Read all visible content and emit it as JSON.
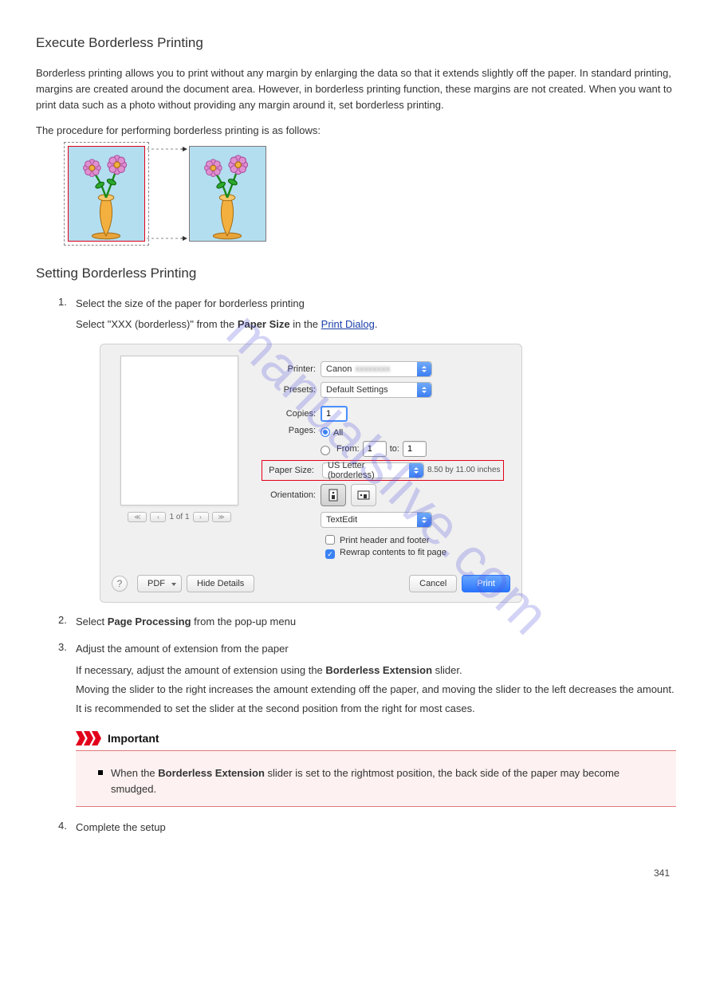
{
  "document": {
    "heading_main": "Execute Borderless Printing",
    "intro1": "Borderless printing allows you to print without any margin by enlarging the data so that it extends slightly off the paper. In standard printing, margins are created around the document area. However, in borderless printing function, these margins are not created. When you want to print data such as a photo without providing any margin around it, set borderless printing.",
    "intro2": "The procedure for performing borderless printing is as follows:",
    "section_setting": "Setting Borderless Printing",
    "step1_num": "1.",
    "step1_text_a": "Select the size of the paper for borderless printing",
    "step1_text_b_1": "Select \"XXX (borderless)\" from the ",
    "step1_text_b_bold": "Paper Size",
    "step1_text_b_2": " in the ",
    "step1_link": "Print Dialog",
    "step1_text_b_3": ".",
    "step2_num": "2.",
    "step2_bold": "Page Processing",
    "step2_text": " from the pop-up menu",
    "step3_num": "3.",
    "step3_text": "Adjust the amount of extension from the paper",
    "step3_para_1": "If necessary, adjust the amount of extension using the ",
    "step3_para_bold": "Borderless Extension",
    "step3_para_2": " slider.",
    "step3_para_3": "Moving the slider to the right increases the amount extending off the paper, and moving the slider to the left decreases the amount.",
    "step3_para_4": "It is recommended to set the slider at the second position from the right for most cases.",
    "important_label": "Important",
    "important_text": "When the Borderless Extension slider is set to the rightmost position, the back side of the paper may become smudged.",
    "step4_num": "4.",
    "step4_text": "Complete the setup",
    "page_number": "341"
  },
  "dialog": {
    "printer_label": "Printer:",
    "printer_value": "Canon",
    "presets_label": "Presets:",
    "presets_value": "Default Settings",
    "copies_label": "Copies:",
    "copies_value": "1",
    "pages_label": "Pages:",
    "pages_all": "All",
    "pages_from": "From:",
    "pages_from_val": "1",
    "pages_to": "to:",
    "pages_to_val": "1",
    "papersize_label": "Paper Size:",
    "papersize_value": "US Letter (borderless)",
    "papersize_dim": "8.50 by 11.00 inches",
    "orientation_label": "Orientation:",
    "popup_value": "TextEdit",
    "opt_header": "Print header and footer",
    "opt_rewrap": "Rewrap contents to fit page",
    "pager_text": "1 of 1",
    "pdf_btn": "PDF",
    "hide_details": "Hide Details",
    "cancel": "Cancel",
    "print": "Print",
    "preview_select_prefix": "Select "
  },
  "watermark": "manualslive.com"
}
